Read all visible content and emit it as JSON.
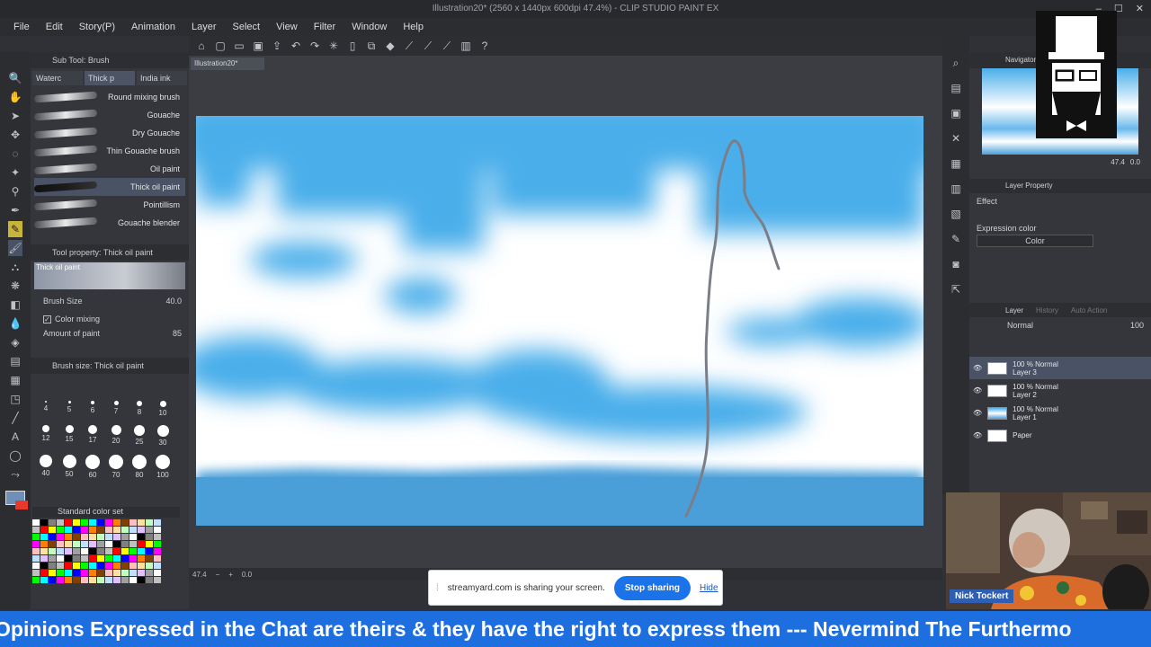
{
  "window": {
    "title": "Illustration20* (2560 x 1440px 600dpi 47.4%) - CLIP STUDIO PAINT EX",
    "controls": [
      "–",
      "☐",
      "✕"
    ]
  },
  "menu": [
    "File",
    "Edit",
    "Story(P)",
    "Animation",
    "Layer",
    "Select",
    "View",
    "Filter",
    "Window",
    "Help"
  ],
  "document_tab": "Illustration20*",
  "subtool": {
    "header": "Sub Tool: Brush",
    "tabs": [
      "Waterc",
      "Thick p",
      "India ink"
    ],
    "brushes": [
      "Round mixing brush",
      "Gouache",
      "Dry Gouache",
      "Thin Gouache brush",
      "Oil paint",
      "Thick oil paint",
      "Pointillism",
      "Gouache blender"
    ],
    "selected_index": 5
  },
  "tool_property": {
    "header": "Tool property: Thick oil paint",
    "preview_label": "Thick oil paint",
    "brush_size_label": "Brush Size",
    "brush_size_value": "40.0",
    "color_mixing_label": "Color mixing",
    "amount_label": "Amount of paint",
    "amount_value": "85"
  },
  "brush_sizes": {
    "header": "Brush size: Thick oil paint",
    "values": [
      "4",
      "5",
      "6",
      "7",
      "8",
      "10",
      "12",
      "15",
      "17",
      "20",
      "25",
      "30",
      "40",
      "50",
      "60",
      "70",
      "80",
      "100"
    ]
  },
  "colorset_label": "Standard color set",
  "status": {
    "zoom": "47.4",
    "angle": "0.0"
  },
  "navigator": {
    "header": "Navigator",
    "zoom": "47.4",
    "angle": "0.0"
  },
  "layer_property": {
    "header": "Layer Property",
    "effect_label": "Effect",
    "expression_label": "Expression color",
    "expression_value": "Color"
  },
  "layers": {
    "tabs": [
      "Layer",
      "History",
      "Auto Action"
    ],
    "blend": "Normal",
    "opacity": "100",
    "items": [
      {
        "mode": "100 % Normal",
        "name": "Layer 3"
      },
      {
        "mode": "100 % Normal",
        "name": "Layer 2"
      },
      {
        "mode": "100 % Normal",
        "name": "Layer 1"
      },
      {
        "mode": "",
        "name": "Paper"
      }
    ],
    "selected_index": 0
  },
  "share_bar": {
    "message": "streamyard.com is sharing your screen.",
    "stop_label": "Stop sharing",
    "hide_label": "Hide"
  },
  "webcam_name": "Nick Tockert",
  "ticker": "Opinions Expressed in the Chat are theirs & they have the right to express them --- Nevermind The Furthermo",
  "colors": {
    "sky_blue": "#4aaeea",
    "water_blue": "#4a9fd9",
    "ticker_blue": "#1d6fe0",
    "stop_button": "#1a73e8"
  }
}
